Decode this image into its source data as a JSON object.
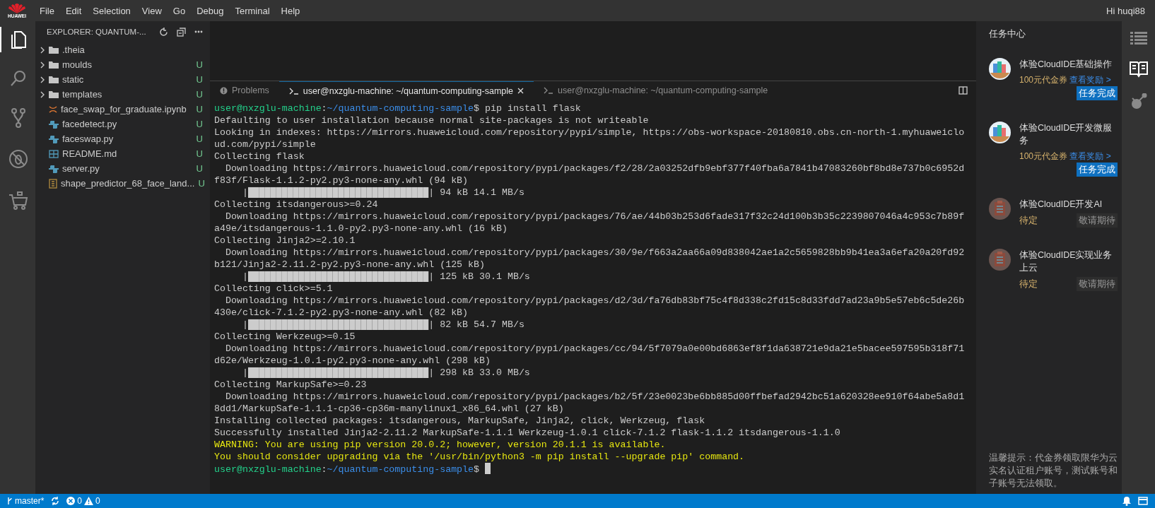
{
  "logo": {
    "text": "HUAWEI"
  },
  "menu": [
    "File",
    "Edit",
    "Selection",
    "View",
    "Go",
    "Debug",
    "Terminal",
    "Help"
  ],
  "user_greeting": "Hi huqi88",
  "activity_bar": [
    {
      "kind": "files",
      "selected": true
    },
    {
      "kind": "search",
      "selected": false
    },
    {
      "kind": "source-control",
      "selected": false
    },
    {
      "kind": "debug",
      "selected": false
    },
    {
      "kind": "extensions",
      "selected": false
    }
  ],
  "explorer": {
    "title": "EXPLORER: QUANTUM-...",
    "items": [
      {
        "kind": "folder",
        "name": ".theia"
      },
      {
        "kind": "folder",
        "name": "moulds",
        "status": "U"
      },
      {
        "kind": "folder",
        "name": "static",
        "status": "U"
      },
      {
        "kind": "folder",
        "name": "templates",
        "status": "U"
      },
      {
        "kind": "notebook",
        "name": "face_swap_for_graduate.ipynb",
        "status": "U"
      },
      {
        "kind": "python",
        "name": "facedetect.py",
        "status": "U"
      },
      {
        "kind": "python",
        "name": "faceswap.py",
        "status": "U"
      },
      {
        "kind": "markdown",
        "name": "README.md",
        "status": "U"
      },
      {
        "kind": "python",
        "name": "server.py",
        "status": "U"
      },
      {
        "kind": "data",
        "name": "shape_predictor_68_face_land...",
        "status": "U"
      }
    ]
  },
  "panel_tabs": [
    {
      "kind": "problems",
      "label": "Problems",
      "selected": false
    },
    {
      "kind": "terminal",
      "label": "user@nxzglu-machine: ~/quantum-computing-sample",
      "selected": true
    },
    {
      "kind": "terminal",
      "label": "user@nxzglu-machine: ~/quantum-computing-sample",
      "selected": false
    }
  ],
  "terminal": {
    "lines": [
      {
        "kind": "prompt",
        "cursor": false,
        "segments": [
          {
            "kind": "user",
            "text": "user@nxzglu-machine"
          },
          {
            "kind": "plain",
            "text": ":"
          },
          {
            "kind": "path",
            "text": "~/quantum-computing-sample"
          },
          {
            "kind": "plain",
            "text": "$ pip install flask"
          }
        ]
      },
      {
        "kind": "output",
        "text": "Defaulting to user installation because normal site-packages is not writeable"
      },
      {
        "kind": "output",
        "text": "Looking in indexes: https://mirrors.huaweicloud.com/repository/pypi/simple, https://obs-workspace-20180810.obs.cn-north-1.myhuaweiclo"
      },
      {
        "kind": "output",
        "text": "ud.com/pypi/simple"
      },
      {
        "kind": "output",
        "text": "Collecting flask"
      },
      {
        "kind": "output",
        "text": "  Downloading https://mirrors.huaweicloud.com/repository/pypi/packages/f2/28/2a03252dfb9ebf377f40fba6a7841b47083260bf8bd8e737b0c6952d"
      },
      {
        "kind": "output",
        "text": "f83f/Flask-1.1.2-py2.py3-none-any.whl (94 kB)"
      },
      {
        "kind": "output",
        "text": "     |████████████████████████████████| 94 kB 14.1 MB/s"
      },
      {
        "kind": "output",
        "text": "Collecting itsdangerous>=0.24"
      },
      {
        "kind": "output",
        "text": "  Downloading https://mirrors.huaweicloud.com/repository/pypi/packages/76/ae/44b03b253d6fade317f32c24d100b3b35c2239807046a4c953c7b89f"
      },
      {
        "kind": "output",
        "text": "a49e/itsdangerous-1.1.0-py2.py3-none-any.whl (16 kB)"
      },
      {
        "kind": "output",
        "text": "Collecting Jinja2>=2.10.1"
      },
      {
        "kind": "output",
        "text": "  Downloading https://mirrors.huaweicloud.com/repository/pypi/packages/30/9e/f663a2aa66a09d838042ae1a2c5659828bb9b41ea3a6efa20a20fd92"
      },
      {
        "kind": "output",
        "text": "b121/Jinja2-2.11.2-py2.py3-none-any.whl (125 kB)"
      },
      {
        "kind": "output",
        "text": "     |████████████████████████████████| 125 kB 30.1 MB/s"
      },
      {
        "kind": "output",
        "text": "Collecting click>=5.1"
      },
      {
        "kind": "output",
        "text": "  Downloading https://mirrors.huaweicloud.com/repository/pypi/packages/d2/3d/fa76db83bf75c4f8d338c2fd15c8d33fdd7ad23a9b5e57eb6c5de26b"
      },
      {
        "kind": "output",
        "text": "430e/click-7.1.2-py2.py3-none-any.whl (82 kB)"
      },
      {
        "kind": "output",
        "text": "     |████████████████████████████████| 82 kB 54.7 MB/s"
      },
      {
        "kind": "output",
        "text": "Collecting Werkzeug>=0.15"
      },
      {
        "kind": "output",
        "text": "  Downloading https://mirrors.huaweicloud.com/repository/pypi/packages/cc/94/5f7079a0e00bd6863ef8f1da638721e9da21e5bacee597595b318f71"
      },
      {
        "kind": "output",
        "text": "d62e/Werkzeug-1.0.1-py2.py3-none-any.whl (298 kB)"
      },
      {
        "kind": "output",
        "text": "     |████████████████████████████████| 298 kB 33.0 MB/s"
      },
      {
        "kind": "output",
        "text": "Collecting MarkupSafe>=0.23"
      },
      {
        "kind": "output",
        "text": "  Downloading https://mirrors.huaweicloud.com/repository/pypi/packages/b2/5f/23e0023be6bb885d00ffbefad2942bc51a620328ee910f64abe5a8d1"
      },
      {
        "kind": "output",
        "text": "8dd1/MarkupSafe-1.1.1-cp36-cp36m-manylinux1_x86_64.whl (27 kB)"
      },
      {
        "kind": "output",
        "text": "Installing collected packages: itsdangerous, MarkupSafe, Jinja2, click, Werkzeug, flask"
      },
      {
        "kind": "output",
        "text": "Successfully installed Jinja2-2.11.2 MarkupSafe-1.1.1 Werkzeug-1.0.1 click-7.1.2 flask-1.1.2 itsdangerous-1.1.0"
      },
      {
        "kind": "warning",
        "text": "WARNING: You are using pip version 20.0.2; however, version 20.1.1 is available."
      },
      {
        "kind": "warning",
        "text": "You should consider upgrading via the '/usr/bin/python3 -m pip install --upgrade pip' command."
      },
      {
        "kind": "prompt",
        "cursor": true,
        "segments": [
          {
            "kind": "user",
            "text": "user@nxzglu-machine"
          },
          {
            "kind": "plain",
            "text": ":"
          },
          {
            "kind": "path",
            "text": "~/quantum-computing-sample"
          },
          {
            "kind": "plain",
            "text": "$"
          }
        ]
      }
    ]
  },
  "task_center": {
    "title": "任务中心",
    "tasks": [
      {
        "kind": "done",
        "title": "体验CloudIDE基础操作",
        "reward": "100元代金券",
        "link": "查看奖励 >",
        "badge": "任务完成"
      },
      {
        "kind": "done",
        "title": "体验CloudIDE开发微服务",
        "reward": "100元代金券",
        "link": "查看奖励 >",
        "badge": "任务完成"
      },
      {
        "kind": "pending",
        "title": "体验CloudIDE开发AI",
        "reward": "待定",
        "badge": "敬请期待"
      },
      {
        "kind": "pending",
        "title": "体验CloudIDE实现业务上云",
        "reward": "待定",
        "badge": "敬请期待"
      }
    ],
    "note": "温馨提示：代金券领取限华为云实名认证租户账号，测试账号和子账号无法领取。"
  },
  "right_bar": [
    {
      "kind": "list",
      "selected": false
    },
    {
      "kind": "book",
      "selected": true
    },
    {
      "kind": "nodes",
      "selected": false
    }
  ],
  "status_bar": {
    "branch": "master*",
    "errors": "0",
    "warnings": "0"
  }
}
